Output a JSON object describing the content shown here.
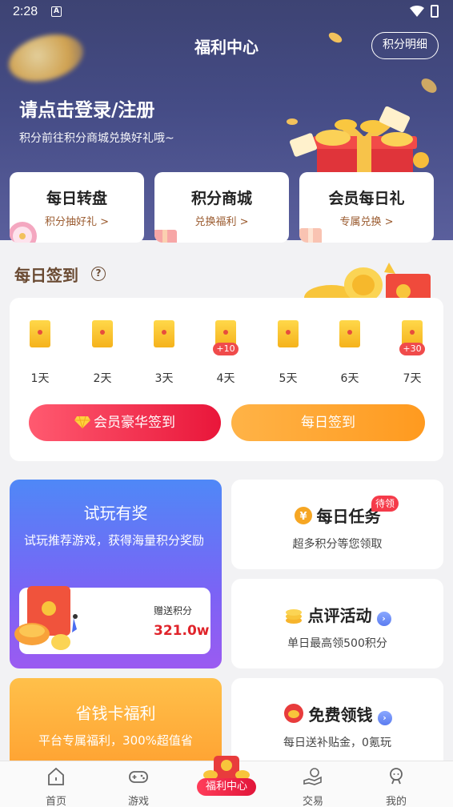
{
  "status_bar": {
    "time": "2:28",
    "notif_letter": "A"
  },
  "header": {
    "title": "福利中心",
    "points_detail_button": "积分明细"
  },
  "login": {
    "title": "请点击登录/注册",
    "subtitle": "积分前往积分商城兑换好礼哦~"
  },
  "quick_cards": [
    {
      "title": "每日转盘",
      "subtitle": "积分抽好礼 >"
    },
    {
      "title": "积分商城",
      "subtitle": "兑换福利 >"
    },
    {
      "title": "会员每日礼",
      "subtitle": "专属兑换 >"
    }
  ],
  "daily_signin": {
    "title": "每日签到",
    "help_icon": "?",
    "days": [
      {
        "label": "1天",
        "bonus": ""
      },
      {
        "label": "2天",
        "bonus": ""
      },
      {
        "label": "3天",
        "bonus": ""
      },
      {
        "label": "4天",
        "bonus": "+10"
      },
      {
        "label": "5天",
        "bonus": ""
      },
      {
        "label": "6天",
        "bonus": ""
      },
      {
        "label": "7天",
        "bonus": "+30"
      }
    ],
    "vip_button": "会员豪华签到",
    "daily_button": "每日签到"
  },
  "try_play": {
    "title": "试玩有奖",
    "desc": "试玩推荐游戏，获得海量积分奖励",
    "give_label": "赠送积分",
    "give_value": "321.0w"
  },
  "daily_task": {
    "title": "每日任务",
    "tag": "待领",
    "subtitle": "超多积分等您领取",
    "icon_glyph": "¥"
  },
  "review": {
    "title": "点评活动",
    "subtitle": "单日最高领500积分",
    "arrow": "›"
  },
  "free_money": {
    "title": "免费领钱",
    "subtitle": "每日送补贴金，0氪玩",
    "arrow": "›"
  },
  "save_card": {
    "title": "省钱卡福利",
    "subtitle": "平台专属福利，300%超值省"
  },
  "tabbar": {
    "items": [
      {
        "label": "首页",
        "icon": "home-icon"
      },
      {
        "label": "游戏",
        "icon": "gamepad-icon"
      },
      {
        "label": "福利中心",
        "icon": "gift-icon"
      },
      {
        "label": "交易",
        "icon": "trade-icon"
      },
      {
        "label": "我的",
        "icon": "profile-icon"
      }
    ]
  },
  "colors": {
    "hero": "#454c86",
    "vip_red": "#e9163a",
    "daily_orange": "#ff9a1f",
    "try_blue": "#4f88f7",
    "try_purple": "#9b5bf1",
    "save_orange": "#ffa030",
    "value_red": "#e0242b"
  }
}
